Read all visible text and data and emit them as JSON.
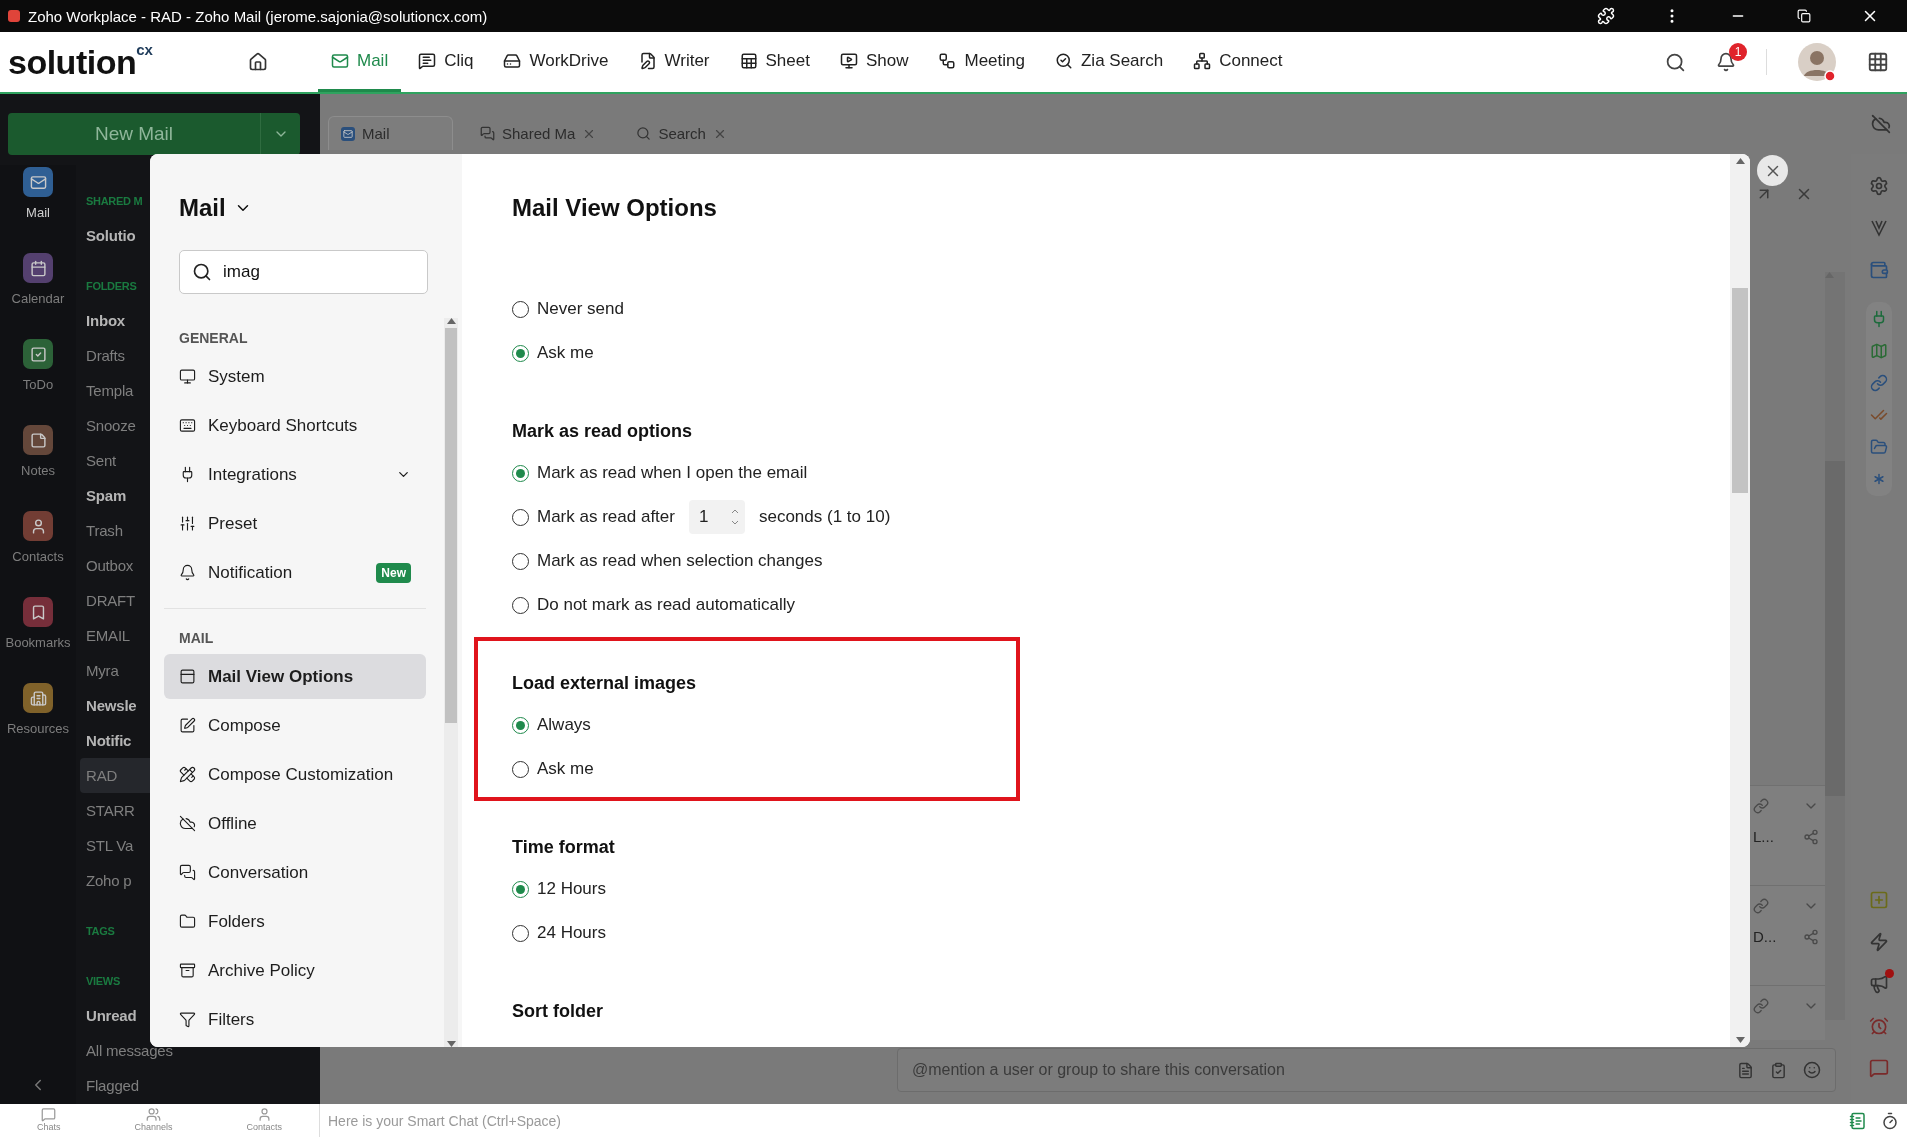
{
  "window": {
    "title": "Zoho Workplace - RAD - Zoho Mail (jerome.sajonia@solutioncx.com)"
  },
  "logo": {
    "text": "solution",
    "superscript": "cx"
  },
  "nav": [
    {
      "label": "Mail",
      "selected": true
    },
    {
      "label": "Cliq",
      "selected": false
    },
    {
      "label": "WorkDrive",
      "selected": false
    },
    {
      "label": "Writer",
      "selected": false
    },
    {
      "label": "Sheet",
      "selected": false
    },
    {
      "label": "Show",
      "selected": false
    },
    {
      "label": "Meeting",
      "selected": false
    },
    {
      "label": "Zia Search",
      "selected": false
    },
    {
      "label": "Connect",
      "selected": false
    }
  ],
  "notifications": {
    "count": "1"
  },
  "new_mail": {
    "label": "New Mail"
  },
  "apps": [
    {
      "label": "Mail",
      "selected": true,
      "color": "#2f5f94"
    },
    {
      "label": "Calendar",
      "selected": false,
      "color": "#54406f"
    },
    {
      "label": "ToDo",
      "selected": false,
      "color": "#2c6238"
    },
    {
      "label": "Notes",
      "selected": false,
      "color": "#64473a"
    },
    {
      "label": "Contacts",
      "selected": false,
      "color": "#723d34"
    },
    {
      "label": "Bookmarks",
      "selected": false,
      "color": "#762e3a"
    },
    {
      "label": "Resources",
      "selected": false,
      "color": "#80622a"
    }
  ],
  "folders": [
    {
      "kind": "heading",
      "label": "SHARED M"
    },
    {
      "kind": "item",
      "label": "Solutio",
      "unread": true,
      "selected": false
    },
    {
      "kind": "heading",
      "label": "FOLDERS"
    },
    {
      "kind": "item",
      "label": "Inbox",
      "unread": true,
      "selected": false
    },
    {
      "kind": "item",
      "label": "Drafts",
      "unread": false,
      "selected": false
    },
    {
      "kind": "item",
      "label": "Templa",
      "unread": false,
      "selected": false
    },
    {
      "kind": "item",
      "label": "Snooze",
      "unread": false,
      "selected": false
    },
    {
      "kind": "item",
      "label": "Sent",
      "unread": false,
      "selected": false
    },
    {
      "kind": "item",
      "label": "Spam",
      "unread": true,
      "selected": false
    },
    {
      "kind": "item",
      "label": "Trash",
      "unread": false,
      "selected": false
    },
    {
      "kind": "item",
      "label": "Outbox",
      "unread": false,
      "selected": false
    },
    {
      "kind": "item",
      "label": "DRAFT",
      "unread": false,
      "selected": false
    },
    {
      "kind": "item",
      "label": "EMAIL",
      "unread": false,
      "selected": false
    },
    {
      "kind": "item",
      "label": "Myra",
      "unread": false,
      "selected": false
    },
    {
      "kind": "item",
      "label": "Newsle",
      "unread": true,
      "selected": false
    },
    {
      "kind": "item",
      "label": "Notific",
      "unread": true,
      "selected": false
    },
    {
      "kind": "item",
      "label": "RAD",
      "unread": false,
      "selected": true
    },
    {
      "kind": "item",
      "label": "STARR",
      "unread": false,
      "selected": false
    },
    {
      "kind": "item",
      "label": "STL Va",
      "unread": false,
      "selected": false
    },
    {
      "kind": "item",
      "label": "Zoho p",
      "unread": false,
      "selected": false
    },
    {
      "kind": "heading",
      "label": "TAGS"
    },
    {
      "kind": "heading",
      "label": "VIEWS"
    },
    {
      "kind": "item",
      "label": "Unread",
      "unread": true,
      "selected": false
    },
    {
      "kind": "item",
      "label": "All messages",
      "unread": false,
      "selected": false
    },
    {
      "kind": "item",
      "label": "Flagged",
      "unread": false,
      "selected": false
    }
  ],
  "mail_tabs": [
    {
      "kind": "mail",
      "label": "Mail",
      "selected": true,
      "closable": false
    },
    {
      "kind": "shared",
      "label": "Shared Ma",
      "selected": false,
      "closable": true
    },
    {
      "kind": "search",
      "label": "Search",
      "selected": false,
      "closable": true
    }
  ],
  "background_rows": [
    {
      "snippet": "L..."
    },
    {
      "snippet": "D..."
    },
    {}
  ],
  "compose": {
    "placeholder": "@mention a user or group to share this conversation"
  },
  "settings": {
    "title": "Mail",
    "search": {
      "value": "imag"
    },
    "groups": [
      {
        "label": "GENERAL",
        "items": [
          {
            "label": "System",
            "selected": false
          },
          {
            "label": "Keyboard Shortcuts",
            "selected": false
          },
          {
            "label": "Integrations",
            "selected": false,
            "expandable": true
          },
          {
            "label": "Preset",
            "selected": false
          },
          {
            "label": "Notification",
            "selected": false,
            "badge": "New"
          }
        ]
      },
      {
        "label": "MAIL",
        "items": [
          {
            "label": "Mail View Options",
            "selected": true
          },
          {
            "label": "Compose",
            "selected": false
          },
          {
            "label": "Compose Customization",
            "selected": false
          },
          {
            "label": "Offline",
            "selected": false
          },
          {
            "label": "Conversation",
            "selected": false
          },
          {
            "label": "Folders",
            "selected": false
          },
          {
            "label": "Archive Policy",
            "selected": false
          },
          {
            "label": "Filters",
            "selected": false
          }
        ]
      }
    ]
  },
  "page": {
    "title": "Mail View Options",
    "sections": [
      {
        "highlighted": false,
        "options": [
          {
            "kind": "radio",
            "label": "Never send",
            "selected": false
          },
          {
            "kind": "radio",
            "label": "Ask me",
            "selected": true
          }
        ]
      },
      {
        "title": "Mark as read options",
        "highlighted": false,
        "options": [
          {
            "kind": "radio",
            "label": "Mark as read when I open the email",
            "selected": true
          },
          {
            "kind": "delay",
            "label": "Mark as read after",
            "value": "1",
            "suffix": "seconds (1 to 10)",
            "selected": false
          },
          {
            "kind": "radio",
            "label": "Mark as read when selection changes",
            "selected": false
          },
          {
            "kind": "radio",
            "label": "Do not mark as read automatically",
            "selected": false
          }
        ]
      },
      {
        "title": "Load external images",
        "highlighted": true,
        "options": [
          {
            "kind": "radio",
            "label": "Always",
            "selected": true
          },
          {
            "kind": "radio",
            "label": "Ask me",
            "selected": false
          }
        ]
      },
      {
        "title": "Time format",
        "highlighted": false,
        "options": [
          {
            "kind": "radio",
            "label": "12 Hours",
            "selected": true
          },
          {
            "kind": "radio",
            "label": "24 Hours",
            "selected": false
          }
        ]
      },
      {
        "title": "Sort folder",
        "highlighted": false
      }
    ]
  },
  "bottom_bar": {
    "tabs": [
      {
        "label": "Chats"
      },
      {
        "label": "Channels"
      },
      {
        "label": "Contacts"
      }
    ],
    "smart_chat": {
      "placeholder": "Here is your Smart Chat (Ctrl+Space)"
    }
  }
}
